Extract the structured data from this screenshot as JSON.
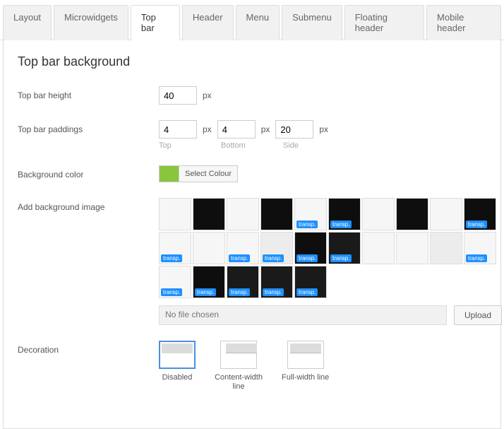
{
  "tabs": {
    "items": [
      {
        "label": "Layout"
      },
      {
        "label": "Microwidgets"
      },
      {
        "label": "Top bar"
      },
      {
        "label": "Header"
      },
      {
        "label": "Menu"
      },
      {
        "label": "Submenu"
      },
      {
        "label": "Floating header"
      },
      {
        "label": "Mobile header"
      }
    ],
    "active": 2
  },
  "section": {
    "title": "Top bar background"
  },
  "height": {
    "label": "Top bar height",
    "value": "40",
    "unit": "px"
  },
  "paddings": {
    "label": "Top bar paddings",
    "top": {
      "value": "4",
      "unit": "px",
      "sub": "Top"
    },
    "bottom": {
      "value": "4",
      "unit": "px",
      "sub": "Bottom"
    },
    "side": {
      "value": "20",
      "unit": "px",
      "sub": "Side"
    }
  },
  "bgcolor": {
    "label": "Background color",
    "button": "Select Colour",
    "hex": "#8ac53e"
  },
  "bgimage": {
    "label": "Add background image",
    "transp_badge": "transp.",
    "thumbs": [
      {
        "tone": "light"
      },
      {
        "tone": "dark2"
      },
      {
        "tone": "light"
      },
      {
        "tone": "dark2"
      },
      {
        "tone": "light",
        "t": true
      },
      {
        "tone": "dark2",
        "t": true
      },
      {
        "tone": "light"
      },
      {
        "tone": "dark2"
      },
      {
        "tone": "light"
      },
      {
        "tone": "dark2",
        "t": true
      },
      {
        "tone": "light",
        "t": true
      },
      {
        "tone": "light"
      },
      {
        "tone": "light",
        "t": true
      },
      {
        "tone": "mid",
        "t": true
      },
      {
        "tone": "dark2",
        "t": true
      },
      {
        "tone": "dark",
        "t": true
      },
      {
        "tone": "light"
      },
      {
        "tone": "light"
      },
      {
        "tone": "mid"
      },
      {
        "tone": "light",
        "t": true
      },
      {
        "tone": "light",
        "t": true
      },
      {
        "tone": "dark2",
        "t": true
      },
      {
        "tone": "dark",
        "t": true
      },
      {
        "tone": "dark",
        "t": true
      },
      {
        "tone": "dark",
        "t": true
      }
    ],
    "file_text": "No file chosen",
    "upload": "Upload"
  },
  "decoration": {
    "label": "Decoration",
    "options": [
      {
        "label": "Disabled"
      },
      {
        "label": "Content-width line"
      },
      {
        "label": "Full-width line"
      }
    ],
    "selected": 0
  }
}
